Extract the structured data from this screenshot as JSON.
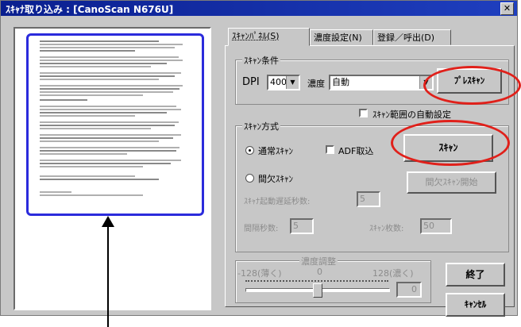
{
  "window": {
    "title": "ｽｷｬﾅ取り込み : [CanoScan N676U]",
    "close_glyph": "✕"
  },
  "tabs": [
    {
      "label": "ｽｷｬﾝﾊﾟﾈﾙ(S)",
      "active": true
    },
    {
      "label": "濃度設定(N)",
      "active": false
    },
    {
      "label": "登録／呼出(D)",
      "active": false
    }
  ],
  "scan_conditions": {
    "group_label": "ｽｷｬﾝ条件",
    "dpi_label": "DPI",
    "dpi_value": "400",
    "density_label": "濃度",
    "density_value": "自動",
    "prescan_label": "ﾌﾟﾚｽｷｬﾝ",
    "auto_area_label": "ｽｷｬﾝ範囲の自動設定"
  },
  "scan_method": {
    "group_label": "ｽｷｬﾝ方式",
    "normal_label": "通常ｽｷｬﾝ",
    "adf_label": "ADF取込",
    "scan_button": "ｽｷｬﾝ",
    "interval_label": "間欠ｽｷｬﾝ",
    "interval_start_button": "間欠ｽｷｬﾝ開始",
    "delay_label": "ｽｷｬﾅ起動遅延秒数:",
    "delay_value": "5",
    "interval_sec_label": "間隔秒数:",
    "interval_sec_value": "5",
    "count_label": "ｽｷｬﾝ枚数:",
    "count_value": "50"
  },
  "density_adjust": {
    "group_label": "濃度調整",
    "min_label": "-128(薄く)",
    "mid_label": "0",
    "max_label": "128(濃く)",
    "value": "0",
    "slider_level": 0.5
  },
  "buttons": {
    "exit": "終了",
    "cancel": "ｷｬﾝｾﾙ"
  },
  "colors": {
    "highlight": "#e0201a",
    "page_frame": "#2b2bdc",
    "title_bar": "#0a1f8f"
  }
}
